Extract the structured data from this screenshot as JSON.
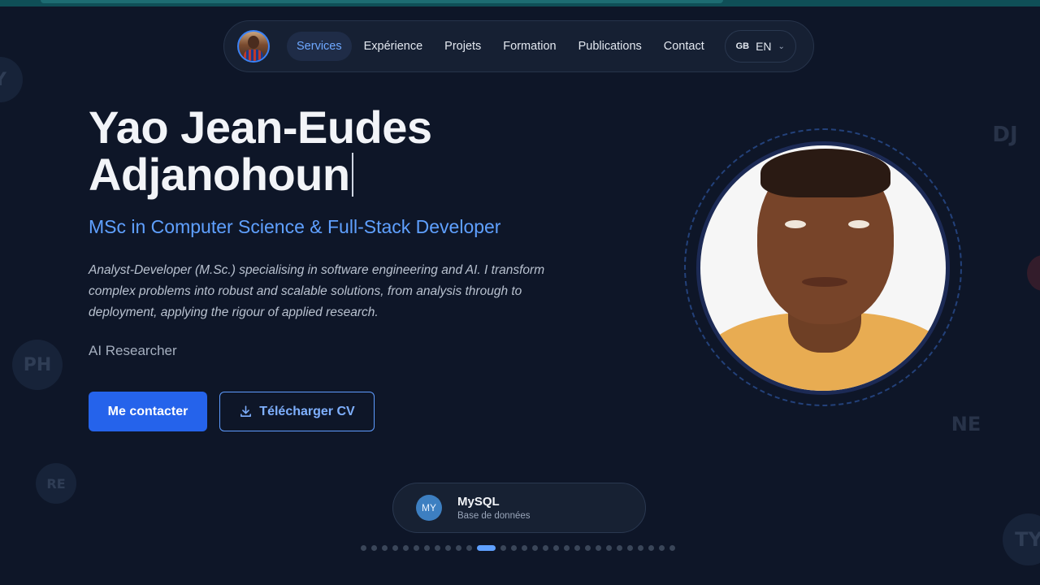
{
  "nav": {
    "items": [
      {
        "label": "Services",
        "active": true
      },
      {
        "label": "Expérience",
        "active": false
      },
      {
        "label": "Projets",
        "active": false
      },
      {
        "label": "Formation",
        "active": false
      },
      {
        "label": "Publications",
        "active": false
      },
      {
        "label": "Contact",
        "active": false
      }
    ],
    "lang": {
      "flag": "GB",
      "code": "EN"
    }
  },
  "hero": {
    "name_line1": "Yao Jean-Eudes",
    "name_line2": "Adjanohoun",
    "role": "MSc in Computer Science & Full-Stack Developer",
    "description": "Analyst-Developer (M.Sc.) specialising in software engineering and AI. I transform complex problems into robust and scalable solutions, from analysis through to deployment, applying the rigour of applied research.",
    "typed_role": "AI Researcher",
    "contact_button": "Me contacter",
    "cv_button": "Télécharger CV"
  },
  "tech": {
    "badge": "MY",
    "name": "MySQL",
    "category": "Base de données",
    "carousel_total": 29,
    "carousel_active_index": 11
  },
  "background_bubbles": [
    "Y",
    "PH",
    "RE",
    "DJ",
    "NE",
    "TY"
  ],
  "colors": {
    "background": "#0e1628",
    "accent": "#2563eb",
    "accent_text": "#5fa0ff"
  }
}
